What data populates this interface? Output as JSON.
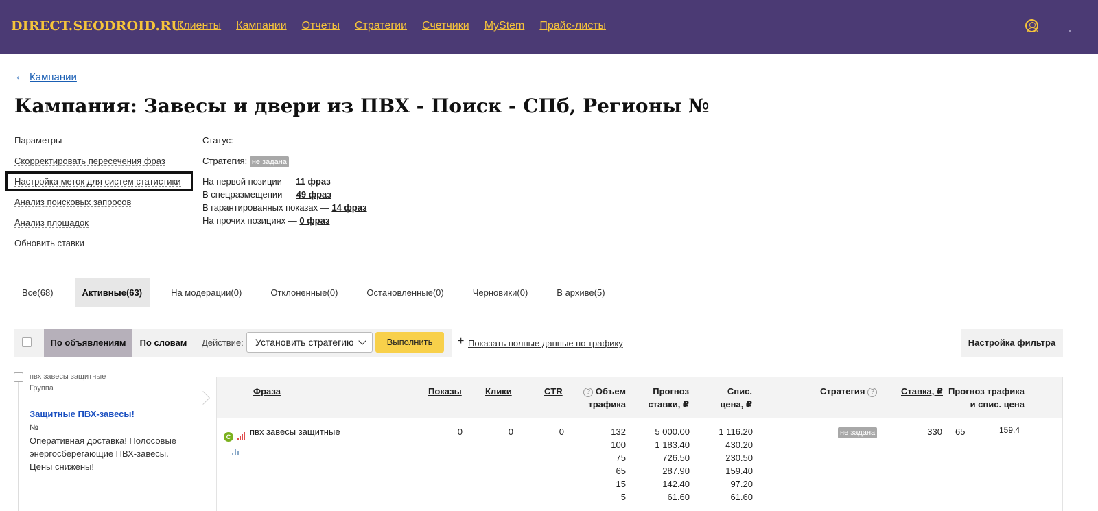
{
  "header": {
    "brand": "DIRECT.SEODROID.RU",
    "nav": [
      "Клиенты",
      "Кампании",
      "Отчеты",
      "Стратегии",
      "Счетчики",
      "MyStem",
      "Прайс-листы"
    ],
    "user_icon": "user-circle-icon",
    "colors": {
      "background": "#4b3a74",
      "accent": "#f5c33b"
    }
  },
  "breadcrumb": {
    "arrow": "←",
    "label": "Кампании"
  },
  "page_title": "Кампания: Завесы и двери из ПВХ - Поиск - СПб, Регионы №",
  "left_links": [
    "Параметры",
    "Скорректировать пересечения фраз",
    "Настройка меток для систем статистики",
    "Анализ поисковых запросов",
    "Анализ площадок",
    "Обновить ставки"
  ],
  "status": {
    "status_label": "Статус:",
    "strategy_label": "Стратегия:",
    "strategy_badge": "не задана",
    "first_pos_label": "На первой позиции —",
    "first_pos_value": "11 фраз",
    "special_label": "В спецразмещении —",
    "special_value": "49 фраз",
    "guaranteed_label": "В гарантированных показах —",
    "guaranteed_value": "14 фраз",
    "other_label": "На прочих позициях —",
    "other_value": "0 фраз"
  },
  "tabs": [
    "Все(68)",
    "Активные(63)",
    "На модерации(0)",
    "Отклоненные(0)",
    "Остановленные(0)",
    "Черновики(0)",
    "В архиве(5)"
  ],
  "active_tab": "Активные(63)",
  "toolbar": {
    "by_ads": "По объявлениям",
    "by_words": "По словам",
    "action_label": "Действие:",
    "action_select": "Установить стратегию",
    "run": "Выполнить",
    "plus": "+",
    "show_traffic": "Показать полные данные по трафику",
    "filter_settings": "Настройка фильтра",
    "colors": {
      "run_button": "#f8d04a",
      "active_segment": "#b6b0ba"
    }
  },
  "group": {
    "name": "пвх завесы защитные",
    "type": "Группа",
    "ad_title": "Защитные ПВХ-завесы!",
    "ad_no": "№",
    "ad_text": "Оперативная доставка! Полосовые энергосберегающие ПВХ-завесы. Цены снижены!"
  },
  "table": {
    "headers": {
      "phrase": "Фраза",
      "impressions": "Показы",
      "clicks": "Клики",
      "ctr": "CTR",
      "volume_1": "Объем",
      "volume_2": "трафика",
      "forecast_1": "Прогноз",
      "forecast_2": "ставки, ₽",
      "writeoff_1": "Спис.",
      "writeoff_2": "цена, ₽",
      "strategy": "Стратегия",
      "bid": "Ставка, ₽",
      "traffic_forecast_1": "Прогноз трафика",
      "traffic_forecast_2": "и спис. цена",
      "help_mark": "?"
    },
    "row": {
      "status_letter": "C",
      "phrase": "пвх завесы защитные",
      "impressions": "0",
      "clicks": "0",
      "ctr": "0",
      "volume": [
        "132",
        "100",
        "75",
        "65",
        "15",
        "5"
      ],
      "forecast_bid": [
        "5 000.00",
        "1 183.40",
        "726.50",
        "287.90",
        "142.40",
        "61.60"
      ],
      "writeoff_price": [
        "1 116.20",
        "430.20",
        "230.50",
        "159.40",
        "97.20",
        "61.60"
      ],
      "strategy_badge": "не задана",
      "bid": "330",
      "traffic_forecast": "65",
      "traffic_forecast_price": "159.4"
    }
  }
}
